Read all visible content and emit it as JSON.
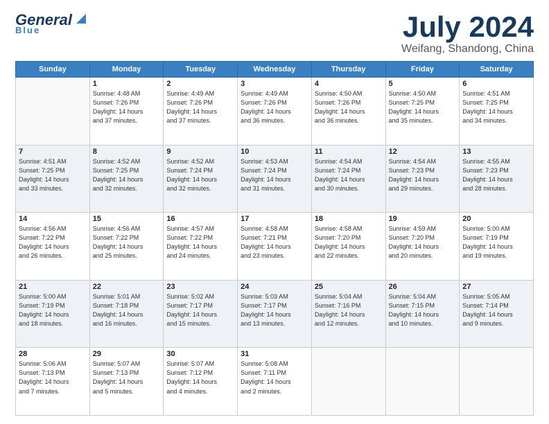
{
  "header": {
    "logo": {
      "general": "General",
      "blue": "Blue"
    },
    "title": "July 2024",
    "location": "Weifang, Shandong, China"
  },
  "calendar": {
    "days": [
      "Sunday",
      "Monday",
      "Tuesday",
      "Wednesday",
      "Thursday",
      "Friday",
      "Saturday"
    ],
    "weeks": [
      [
        {
          "date": "",
          "info": ""
        },
        {
          "date": "1",
          "info": "Sunrise: 4:48 AM\nSunset: 7:26 PM\nDaylight: 14 hours\nand 37 minutes."
        },
        {
          "date": "2",
          "info": "Sunrise: 4:49 AM\nSunset: 7:26 PM\nDaylight: 14 hours\nand 37 minutes."
        },
        {
          "date": "3",
          "info": "Sunrise: 4:49 AM\nSunset: 7:26 PM\nDaylight: 14 hours\nand 36 minutes."
        },
        {
          "date": "4",
          "info": "Sunrise: 4:50 AM\nSunset: 7:26 PM\nDaylight: 14 hours\nand 36 minutes."
        },
        {
          "date": "5",
          "info": "Sunrise: 4:50 AM\nSunset: 7:25 PM\nDaylight: 14 hours\nand 35 minutes."
        },
        {
          "date": "6",
          "info": "Sunrise: 4:51 AM\nSunset: 7:25 PM\nDaylight: 14 hours\nand 34 minutes."
        }
      ],
      [
        {
          "date": "7",
          "info": "Sunrise: 4:51 AM\nSunset: 7:25 PM\nDaylight: 14 hours\nand 33 minutes."
        },
        {
          "date": "8",
          "info": "Sunrise: 4:52 AM\nSunset: 7:25 PM\nDaylight: 14 hours\nand 32 minutes."
        },
        {
          "date": "9",
          "info": "Sunrise: 4:52 AM\nSunset: 7:24 PM\nDaylight: 14 hours\nand 32 minutes."
        },
        {
          "date": "10",
          "info": "Sunrise: 4:53 AM\nSunset: 7:24 PM\nDaylight: 14 hours\nand 31 minutes."
        },
        {
          "date": "11",
          "info": "Sunrise: 4:54 AM\nSunset: 7:24 PM\nDaylight: 14 hours\nand 30 minutes."
        },
        {
          "date": "12",
          "info": "Sunrise: 4:54 AM\nSunset: 7:23 PM\nDaylight: 14 hours\nand 29 minutes."
        },
        {
          "date": "13",
          "info": "Sunrise: 4:55 AM\nSunset: 7:23 PM\nDaylight: 14 hours\nand 28 minutes."
        }
      ],
      [
        {
          "date": "14",
          "info": "Sunrise: 4:56 AM\nSunset: 7:22 PM\nDaylight: 14 hours\nand 26 minutes."
        },
        {
          "date": "15",
          "info": "Sunrise: 4:56 AM\nSunset: 7:22 PM\nDaylight: 14 hours\nand 25 minutes."
        },
        {
          "date": "16",
          "info": "Sunrise: 4:57 AM\nSunset: 7:22 PM\nDaylight: 14 hours\nand 24 minutes."
        },
        {
          "date": "17",
          "info": "Sunrise: 4:58 AM\nSunset: 7:21 PM\nDaylight: 14 hours\nand 23 minutes."
        },
        {
          "date": "18",
          "info": "Sunrise: 4:58 AM\nSunset: 7:20 PM\nDaylight: 14 hours\nand 22 minutes."
        },
        {
          "date": "19",
          "info": "Sunrise: 4:59 AM\nSunset: 7:20 PM\nDaylight: 14 hours\nand 20 minutes."
        },
        {
          "date": "20",
          "info": "Sunrise: 5:00 AM\nSunset: 7:19 PM\nDaylight: 14 hours\nand 19 minutes."
        }
      ],
      [
        {
          "date": "21",
          "info": "Sunrise: 5:00 AM\nSunset: 7:19 PM\nDaylight: 14 hours\nand 18 minutes."
        },
        {
          "date": "22",
          "info": "Sunrise: 5:01 AM\nSunset: 7:18 PM\nDaylight: 14 hours\nand 16 minutes."
        },
        {
          "date": "23",
          "info": "Sunrise: 5:02 AM\nSunset: 7:17 PM\nDaylight: 14 hours\nand 15 minutes."
        },
        {
          "date": "24",
          "info": "Sunrise: 5:03 AM\nSunset: 7:17 PM\nDaylight: 14 hours\nand 13 minutes."
        },
        {
          "date": "25",
          "info": "Sunrise: 5:04 AM\nSunset: 7:16 PM\nDaylight: 14 hours\nand 12 minutes."
        },
        {
          "date": "26",
          "info": "Sunrise: 5:04 AM\nSunset: 7:15 PM\nDaylight: 14 hours\nand 10 minutes."
        },
        {
          "date": "27",
          "info": "Sunrise: 5:05 AM\nSunset: 7:14 PM\nDaylight: 14 hours\nand 9 minutes."
        }
      ],
      [
        {
          "date": "28",
          "info": "Sunrise: 5:06 AM\nSunset: 7:13 PM\nDaylight: 14 hours\nand 7 minutes."
        },
        {
          "date": "29",
          "info": "Sunrise: 5:07 AM\nSunset: 7:13 PM\nDaylight: 14 hours\nand 5 minutes."
        },
        {
          "date": "30",
          "info": "Sunrise: 5:07 AM\nSunset: 7:12 PM\nDaylight: 14 hours\nand 4 minutes."
        },
        {
          "date": "31",
          "info": "Sunrise: 5:08 AM\nSunset: 7:11 PM\nDaylight: 14 hours\nand 2 minutes."
        },
        {
          "date": "",
          "info": ""
        },
        {
          "date": "",
          "info": ""
        },
        {
          "date": "",
          "info": ""
        }
      ]
    ]
  }
}
